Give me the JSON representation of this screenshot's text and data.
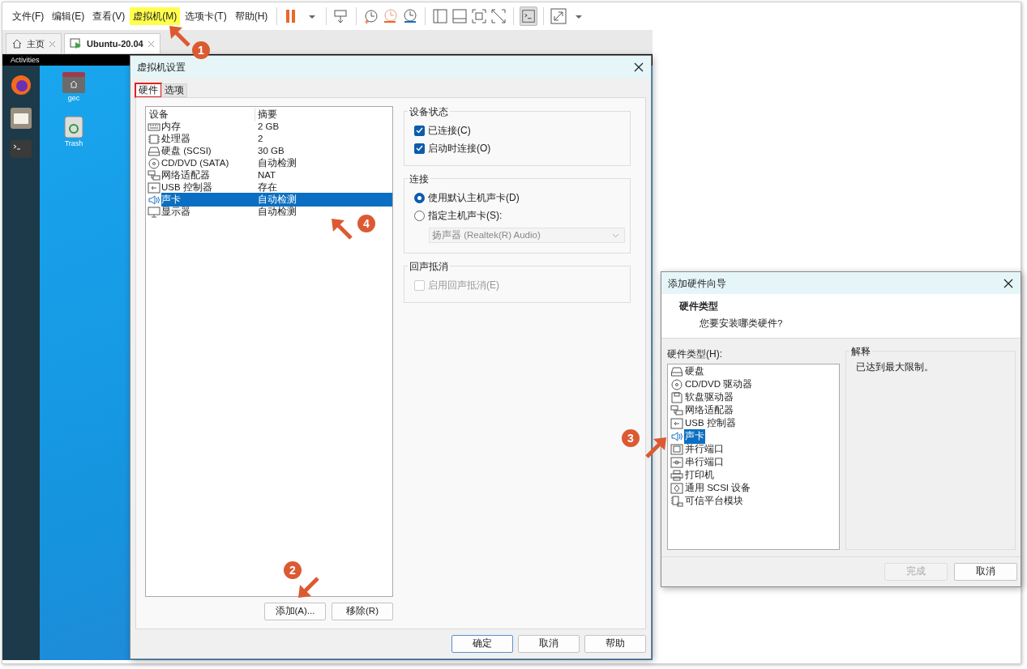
{
  "menu": [
    {
      "label": "文件(F)",
      "highlighted": false
    },
    {
      "label": "编辑(E)",
      "highlighted": false
    },
    {
      "label": "查看(V)",
      "highlighted": false
    },
    {
      "label": "虚拟机(M)",
      "highlighted": true
    },
    {
      "label": "选项卡(T)",
      "highlighted": false
    },
    {
      "label": "帮助(H)",
      "highlighted": false
    }
  ],
  "tabs": [
    {
      "label": "主页",
      "kind": "home",
      "selected": false
    },
    {
      "label": "Ubuntu-20.04",
      "kind": "vm",
      "selected": true
    }
  ],
  "guest": {
    "top_bar": "Activities",
    "desktop_icons": [
      {
        "label": "gec",
        "kind": "home"
      },
      {
        "label": "Trash",
        "kind": "trash"
      }
    ]
  },
  "settings_dialog": {
    "title": "虚拟机设置",
    "tabs": [
      {
        "label": "硬件",
        "selected": true,
        "outlined": true
      },
      {
        "label": "选项",
        "selected": false,
        "outlined": false
      }
    ],
    "device_table": {
      "columns": [
        "设备",
        "摘要"
      ],
      "rows": [
        {
          "kind": "memory",
          "device": "内存",
          "summary": "2 GB",
          "selected": false
        },
        {
          "kind": "cpu",
          "device": "处理器",
          "summary": "2",
          "selected": false
        },
        {
          "kind": "disk",
          "device": "硬盘 (SCSI)",
          "summary": "30 GB",
          "selected": false
        },
        {
          "kind": "cd",
          "device": "CD/DVD (SATA)",
          "summary": "自动检测",
          "selected": false
        },
        {
          "kind": "network",
          "device": "网络适配器",
          "summary": "NAT",
          "selected": false
        },
        {
          "kind": "usb",
          "device": "USB 控制器",
          "summary": "存在",
          "selected": false
        },
        {
          "kind": "sound",
          "device": "声卡",
          "summary": "自动检测",
          "selected": true
        },
        {
          "kind": "display",
          "device": "显示器",
          "summary": "自动检测",
          "selected": false
        }
      ]
    },
    "list_buttons": [
      "添加(A)...",
      "移除(R)"
    ],
    "device_status": {
      "title": "设备状态",
      "options": [
        {
          "label": "已连接(C)",
          "checked": true,
          "disabled": false
        },
        {
          "label": "启动时连接(O)",
          "checked": true,
          "disabled": false
        }
      ]
    },
    "connection": {
      "title": "连接",
      "options": [
        {
          "label": "使用默认主机声卡(D)",
          "selected": true
        },
        {
          "label": "指定主机声卡(S):",
          "selected": false
        }
      ],
      "select": {
        "value": "扬声器 (Realtek(R) Audio)",
        "disabled": true
      }
    },
    "echo": {
      "title": "回声抵消",
      "options": [
        {
          "label": "启用回声抵消(E)",
          "checked": false,
          "disabled": true
        }
      ]
    },
    "footer_buttons": [
      {
        "label": "确定",
        "default": true
      },
      {
        "label": "取消",
        "default": false
      },
      {
        "label": "帮助",
        "default": false
      }
    ]
  },
  "wizard": {
    "title": "添加硬件向导",
    "heading": "硬件类型",
    "subheading": "您要安装哪类硬件?",
    "list_label": "硬件类型(H):",
    "hardware_types": [
      {
        "kind": "disk",
        "label": "硬盘",
        "selected": false
      },
      {
        "kind": "cd",
        "label": "CD/DVD 驱动器",
        "selected": false
      },
      {
        "kind": "floppy",
        "label": "软盘驱动器",
        "selected": false
      },
      {
        "kind": "network",
        "label": "网络适配器",
        "selected": false
      },
      {
        "kind": "usb",
        "label": "USB 控制器",
        "selected": false
      },
      {
        "kind": "sound",
        "label": "声卡",
        "selected": true
      },
      {
        "kind": "parallel",
        "label": "并行端口",
        "selected": false
      },
      {
        "kind": "serial",
        "label": "串行端口",
        "selected": false
      },
      {
        "kind": "printer",
        "label": "打印机",
        "selected": false
      },
      {
        "kind": "scsi",
        "label": "通用 SCSI 设备",
        "selected": false
      },
      {
        "kind": "tpm",
        "label": "可信平台模块",
        "selected": false
      }
    ],
    "explanation_title": "解释",
    "explanation": "已达到最大限制。",
    "buttons": [
      {
        "label": "完成",
        "disabled": true
      },
      {
        "label": "取消",
        "disabled": false
      }
    ]
  },
  "annotations": [
    {
      "number": "1"
    },
    {
      "number": "2"
    },
    {
      "number": "3"
    },
    {
      "number": "4"
    }
  ]
}
